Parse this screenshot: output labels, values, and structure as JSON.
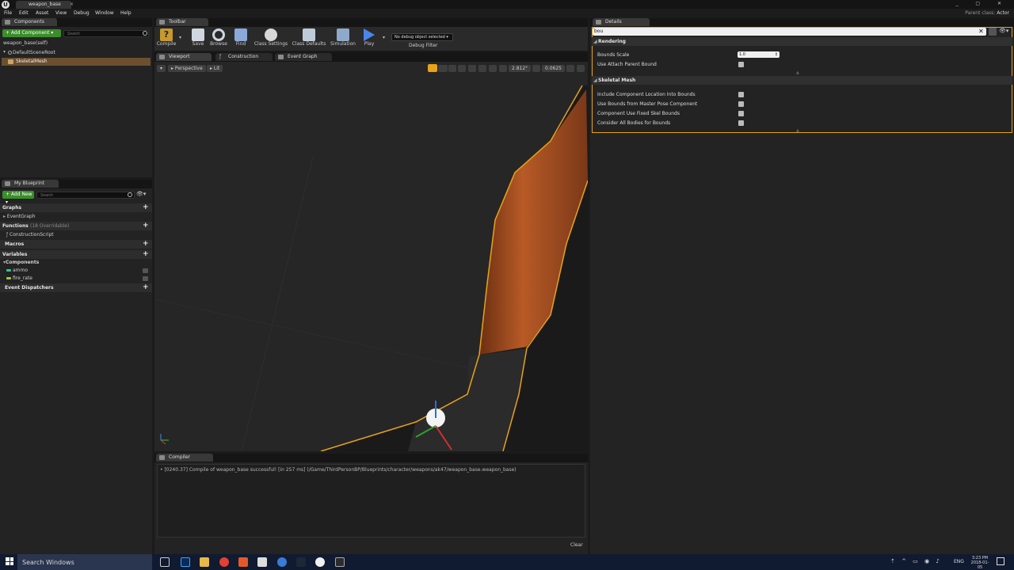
{
  "window": {
    "tab_title": "weapon_base",
    "parent_class_label": "Parent class:",
    "parent_class_value": "Actor",
    "controls": "_ ▢ ✕"
  },
  "menu": [
    "File",
    "Edit",
    "Asset",
    "View",
    "Debug",
    "Window",
    "Help"
  ],
  "components_panel": {
    "tab": "Components",
    "add_button": "+ Add Component ▾",
    "search_placeholder": "Search",
    "self_label": "weapon_base(self)",
    "tree": [
      "DefaultSceneRoot",
      "SkeletalMesh"
    ]
  },
  "my_blueprint": {
    "tab": "My Blueprint",
    "add_button": "+ Add New ▾",
    "search_placeholder": "Search",
    "graphs_label": "Graphs",
    "event_graph": "EventGraph",
    "functions_label": "Functions",
    "functions_overridable": "(18 Overridable)",
    "construction_script": "ConstructionScript",
    "macros_label": "Macros",
    "variables_label": "Variables",
    "components_label": "Components",
    "vars": [
      {
        "name": "ammo",
        "color": "#33c88a"
      },
      {
        "name": "fire_rate",
        "color": "#9acd32"
      }
    ],
    "event_dispatchers_label": "Event Dispatchers"
  },
  "toolbar": {
    "tab": "Toolbar",
    "buttons": [
      "Compile",
      "Save",
      "Browse",
      "Find",
      "Class Settings",
      "Class Defaults",
      "Simulation",
      "Play"
    ],
    "debug_object": "No debug object selected ▾",
    "debug_filter": "Debug Filter"
  },
  "viewport_tabs": [
    "Viewport",
    "Construction Script",
    "Event Graph"
  ],
  "viewport": {
    "perspective": "Perspective",
    "lit": "Lit",
    "angle_snap": "2.812°",
    "scale_snap": "0.0625"
  },
  "compiler": {
    "tab": "Compiler Results",
    "message": "• [0240.37] Compile of weapon_base successful! [in 257 ms] (/Game/ThirdPersonBP/Blueprints/character/weapons/ak47/weapon_base.weapon_base)",
    "clear": "Clear"
  },
  "details": {
    "tab": "Details",
    "search_value": "bou",
    "rendering_label": "Rendering",
    "bounds_scale_label": "Bounds Scale",
    "bounds_scale_value": "1.0",
    "use_attach_parent_bound": "Use Attach Parent Bound",
    "skeletal_mesh_label": "Skeletal Mesh",
    "skeletal_rows": [
      "Include Component Location Into Bounds",
      "Use Bounds from Master Pose Component",
      "Component Use Fixed Skel Bounds",
      "Consider All Bodies for Bounds"
    ]
  },
  "taskbar": {
    "search": "Search Windows",
    "language": "ENG",
    "time": "3:23 PM",
    "date": "2018-01-05"
  },
  "colors": {
    "accent": "#e8a317",
    "selection": "#6b4f2e",
    "green": "#3a8e2a"
  }
}
